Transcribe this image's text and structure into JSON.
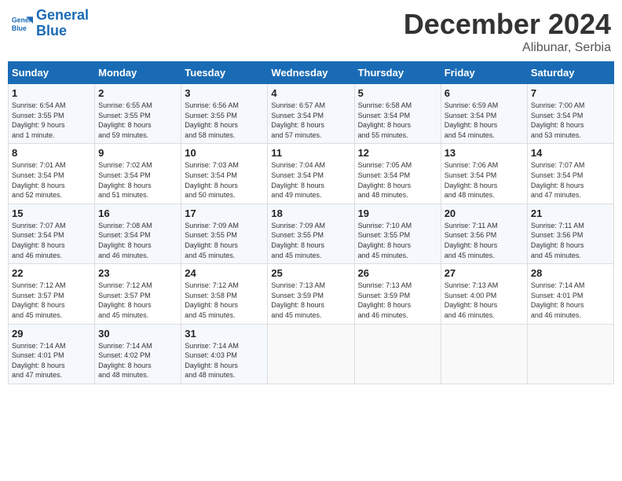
{
  "header": {
    "logo_line1": "General",
    "logo_line2": "Blue",
    "month": "December 2024",
    "location": "Alibunar, Serbia"
  },
  "days_of_week": [
    "Sunday",
    "Monday",
    "Tuesday",
    "Wednesday",
    "Thursday",
    "Friday",
    "Saturday"
  ],
  "weeks": [
    [
      {
        "day": "1",
        "info": "Sunrise: 6:54 AM\nSunset: 3:55 PM\nDaylight: 9 hours\nand 1 minute."
      },
      {
        "day": "2",
        "info": "Sunrise: 6:55 AM\nSunset: 3:55 PM\nDaylight: 8 hours\nand 59 minutes."
      },
      {
        "day": "3",
        "info": "Sunrise: 6:56 AM\nSunset: 3:55 PM\nDaylight: 8 hours\nand 58 minutes."
      },
      {
        "day": "4",
        "info": "Sunrise: 6:57 AM\nSunset: 3:54 PM\nDaylight: 8 hours\nand 57 minutes."
      },
      {
        "day": "5",
        "info": "Sunrise: 6:58 AM\nSunset: 3:54 PM\nDaylight: 8 hours\nand 55 minutes."
      },
      {
        "day": "6",
        "info": "Sunrise: 6:59 AM\nSunset: 3:54 PM\nDaylight: 8 hours\nand 54 minutes."
      },
      {
        "day": "7",
        "info": "Sunrise: 7:00 AM\nSunset: 3:54 PM\nDaylight: 8 hours\nand 53 minutes."
      }
    ],
    [
      {
        "day": "8",
        "info": "Sunrise: 7:01 AM\nSunset: 3:54 PM\nDaylight: 8 hours\nand 52 minutes."
      },
      {
        "day": "9",
        "info": "Sunrise: 7:02 AM\nSunset: 3:54 PM\nDaylight: 8 hours\nand 51 minutes."
      },
      {
        "day": "10",
        "info": "Sunrise: 7:03 AM\nSunset: 3:54 PM\nDaylight: 8 hours\nand 50 minutes."
      },
      {
        "day": "11",
        "info": "Sunrise: 7:04 AM\nSunset: 3:54 PM\nDaylight: 8 hours\nand 49 minutes."
      },
      {
        "day": "12",
        "info": "Sunrise: 7:05 AM\nSunset: 3:54 PM\nDaylight: 8 hours\nand 48 minutes."
      },
      {
        "day": "13",
        "info": "Sunrise: 7:06 AM\nSunset: 3:54 PM\nDaylight: 8 hours\nand 48 minutes."
      },
      {
        "day": "14",
        "info": "Sunrise: 7:07 AM\nSunset: 3:54 PM\nDaylight: 8 hours\nand 47 minutes."
      }
    ],
    [
      {
        "day": "15",
        "info": "Sunrise: 7:07 AM\nSunset: 3:54 PM\nDaylight: 8 hours\nand 46 minutes."
      },
      {
        "day": "16",
        "info": "Sunrise: 7:08 AM\nSunset: 3:54 PM\nDaylight: 8 hours\nand 46 minutes."
      },
      {
        "day": "17",
        "info": "Sunrise: 7:09 AM\nSunset: 3:55 PM\nDaylight: 8 hours\nand 45 minutes."
      },
      {
        "day": "18",
        "info": "Sunrise: 7:09 AM\nSunset: 3:55 PM\nDaylight: 8 hours\nand 45 minutes."
      },
      {
        "day": "19",
        "info": "Sunrise: 7:10 AM\nSunset: 3:55 PM\nDaylight: 8 hours\nand 45 minutes."
      },
      {
        "day": "20",
        "info": "Sunrise: 7:11 AM\nSunset: 3:56 PM\nDaylight: 8 hours\nand 45 minutes."
      },
      {
        "day": "21",
        "info": "Sunrise: 7:11 AM\nSunset: 3:56 PM\nDaylight: 8 hours\nand 45 minutes."
      }
    ],
    [
      {
        "day": "22",
        "info": "Sunrise: 7:12 AM\nSunset: 3:57 PM\nDaylight: 8 hours\nand 45 minutes."
      },
      {
        "day": "23",
        "info": "Sunrise: 7:12 AM\nSunset: 3:57 PM\nDaylight: 8 hours\nand 45 minutes."
      },
      {
        "day": "24",
        "info": "Sunrise: 7:12 AM\nSunset: 3:58 PM\nDaylight: 8 hours\nand 45 minutes."
      },
      {
        "day": "25",
        "info": "Sunrise: 7:13 AM\nSunset: 3:59 PM\nDaylight: 8 hours\nand 45 minutes."
      },
      {
        "day": "26",
        "info": "Sunrise: 7:13 AM\nSunset: 3:59 PM\nDaylight: 8 hours\nand 46 minutes."
      },
      {
        "day": "27",
        "info": "Sunrise: 7:13 AM\nSunset: 4:00 PM\nDaylight: 8 hours\nand 46 minutes."
      },
      {
        "day": "28",
        "info": "Sunrise: 7:14 AM\nSunset: 4:01 PM\nDaylight: 8 hours\nand 46 minutes."
      }
    ],
    [
      {
        "day": "29",
        "info": "Sunrise: 7:14 AM\nSunset: 4:01 PM\nDaylight: 8 hours\nand 47 minutes."
      },
      {
        "day": "30",
        "info": "Sunrise: 7:14 AM\nSunset: 4:02 PM\nDaylight: 8 hours\nand 48 minutes."
      },
      {
        "day": "31",
        "info": "Sunrise: 7:14 AM\nSunset: 4:03 PM\nDaylight: 8 hours\nand 48 minutes."
      },
      {
        "day": "",
        "info": ""
      },
      {
        "day": "",
        "info": ""
      },
      {
        "day": "",
        "info": ""
      },
      {
        "day": "",
        "info": ""
      }
    ]
  ]
}
